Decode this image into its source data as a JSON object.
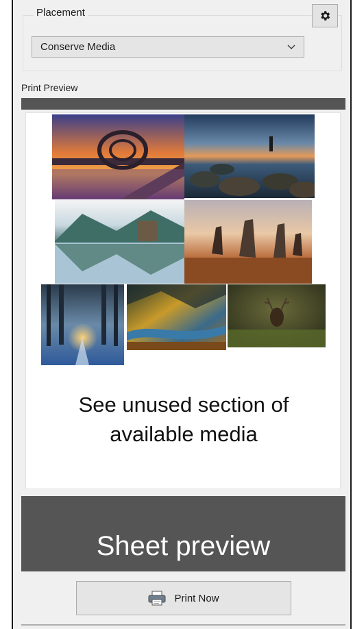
{
  "placement": {
    "group_label": "Placement",
    "settings_icon": "gear-icon",
    "dropdown_value": "Conserve Media",
    "dropdown_icon": "chevron-down-icon"
  },
  "print_preview": {
    "label": "Print Preview",
    "progress_percent": 100,
    "photos": [
      "falkirk-wheel-sunset",
      "rocky-coast-lighthouse",
      "castle-loch-reflection",
      "standing-stones-sunset",
      "snowy-forest-sunrise",
      "autumn-valley-river",
      "stag-in-grass"
    ],
    "unused_text_line1": "See unused section of",
    "unused_text_line2": "available media"
  },
  "sheet_preview": {
    "label": "Sheet preview"
  },
  "print_button": {
    "label": "Print Now",
    "icon": "printer-icon"
  },
  "colors": {
    "panel_bg": "#f0f0f0",
    "dark_bar": "#555555",
    "button_bg": "#e5e5e5"
  }
}
